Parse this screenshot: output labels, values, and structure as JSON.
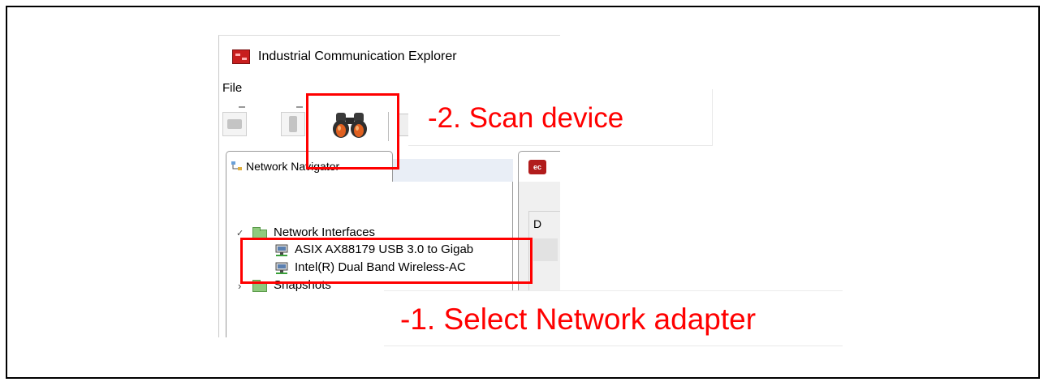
{
  "window": {
    "title": "Industrial Communication Explorer"
  },
  "menu": {
    "file_label": "File"
  },
  "navigator": {
    "tab_label": "Network Navigator",
    "tree": [
      {
        "label": "Network Interfaces",
        "expanded": true
      },
      {
        "label": "ASIX AX88179 USB 3.0 to Gigab"
      },
      {
        "label": "Intel(R) Dual Band Wireless-AC"
      },
      {
        "label": "Snapshots",
        "expanded": false
      }
    ]
  },
  "right_panel": {
    "partial_label": "D"
  },
  "annotations": {
    "step2": "-2. Scan device",
    "step1": "-1. Select Network adapter",
    "highlight_color": "#ff0000"
  },
  "icons": {
    "app": "app-logo-icon",
    "scan": "binoculars-icon",
    "folder": "folder-icon",
    "adapter": "network-adapter-icon"
  }
}
